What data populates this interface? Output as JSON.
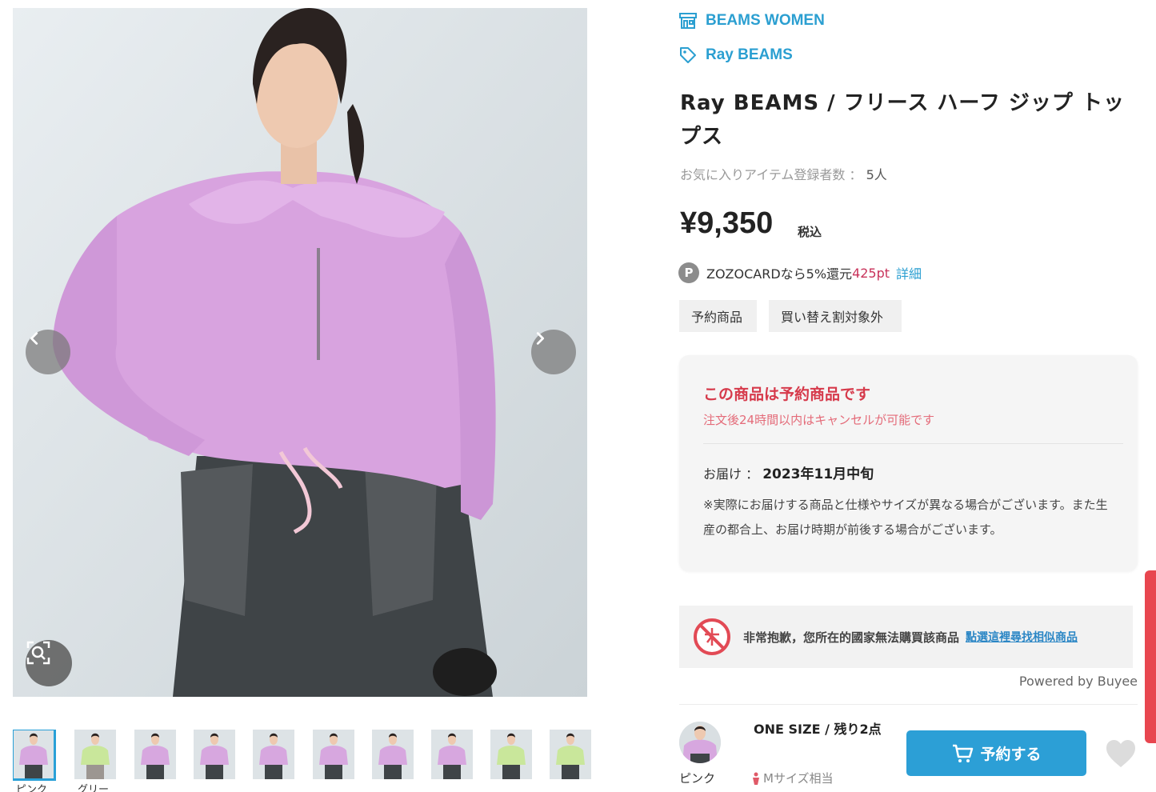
{
  "gallery": {
    "prev_icon": "chevron-left-icon",
    "next_icon": "chevron-right-icon",
    "zoom_icon": "zoom-search-icon",
    "thumbnails": [
      {
        "label": "ピンク",
        "color": "#d7a7df"
      },
      {
        "label": "グリー",
        "color": "#c9e79b"
      },
      {
        "label": "",
        "color": "#d7a7df"
      },
      {
        "label": "",
        "color": "#d7a7df"
      },
      {
        "label": "",
        "color": "#d7a7df"
      },
      {
        "label": "",
        "color": "#d7a7df"
      },
      {
        "label": "",
        "color": "#d7a7df"
      },
      {
        "label": "",
        "color": "#d7a7df"
      },
      {
        "label": "",
        "color": "#c9e79b"
      },
      {
        "label": "",
        "color": "#c9e79b"
      }
    ]
  },
  "shop": {
    "name": "BEAMS WOMEN",
    "icon": "store-icon"
  },
  "brand": {
    "name": "Ray BEAMS",
    "icon": "tag-icon"
  },
  "product": {
    "title": "Ray BEAMS / フリース ハーフ ジップ トップス",
    "favorites_label": "お気に入りアイテム登録者数 ： ",
    "favorites_count": "5人",
    "price": "¥9,350",
    "tax_label": "税込"
  },
  "points": {
    "badge": "P",
    "text": "ZOZOCARDなら5%還元",
    "amount": "425pt",
    "link": "詳細"
  },
  "tags": [
    "予約商品",
    "買い替え割対象外"
  ],
  "preorder": {
    "title": "この商品は予約商品です",
    "subtitle": "注文後24時間以内はキャンセルが可能です",
    "delivery_label": "お届け ： ",
    "delivery_date": "2023年11月中旬",
    "note": "※実際にお届けする商品と仕様やサイズが異なる場合がございます。また生産の都合上、お届け時期が前後する場合がございます。"
  },
  "buyee": {
    "message": "非常抱歉，您所在的國家無法購買該商品",
    "link": "點選這裡尋找相似商品",
    "powered": "Powered by Buyee"
  },
  "sku": {
    "color_label": "ピンク",
    "size_stock": "ONE SIZE / 残り2点",
    "fit": "Mサイズ相当"
  },
  "actions": {
    "reserve_label": "予約する",
    "cart_icon": "cart-icon",
    "favorite_icon": "heart-icon"
  },
  "colors": {
    "accent": "#2c9fd6",
    "alert": "#d63a4b",
    "points": "#c8325a"
  }
}
